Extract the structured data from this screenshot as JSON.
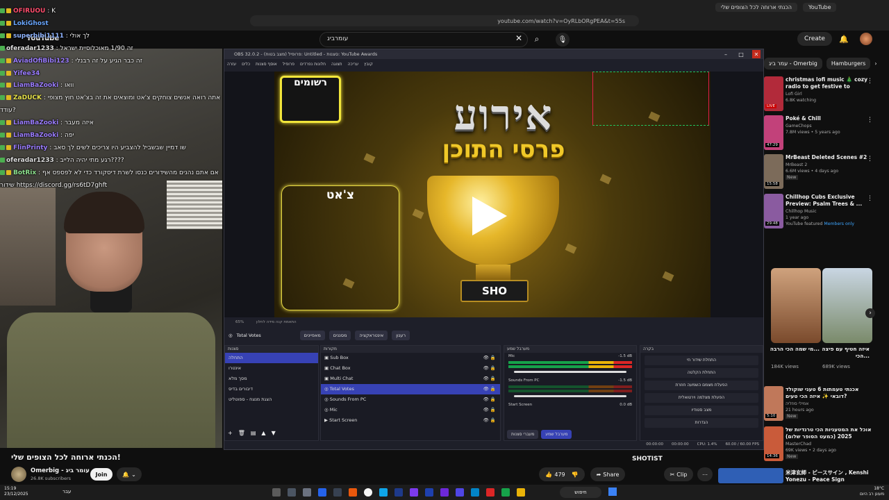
{
  "browser": {
    "tabs": [
      "הכנתי ארוחה לכל הצופים שלי",
      "YouTube"
    ],
    "url": "youtube.com/watch?v=OyRLbORgPEA&t=55s"
  },
  "yt": {
    "logo": "YouTube",
    "search_value": "עומרביג",
    "create_label": "Create"
  },
  "chat": [
    {
      "name": "OFIRUOU",
      "text": "K",
      "color": "#ff4d6d"
    },
    {
      "name": "LokiGhost",
      "text": "",
      "color": "#6aa7ff"
    },
    {
      "name": "superbibi1111",
      "text": "לך אולי",
      "color": "#8fb4ff"
    },
    {
      "name": "oferadar1233",
      "text": "זה 1/90 מאוכלוסיית ישראל",
      "color": "#dddddd"
    },
    {
      "name": "AviadOfiBibi123",
      "text": "זה כבר הגיע על זה רבנלי",
      "color": "#9b7dff"
    },
    {
      "name": "Yifee34",
      "text": "",
      "color": "#9b7dff"
    },
    {
      "name": "LiamBaZooki",
      "text": "וואו",
      "color": "#9b7dff"
    },
    {
      "name": "ZaDUCK",
      "text": "אתה רואה אנשים צוחקים צ'אט ומוצאים את זה בצ'אט חוץ מצופי",
      "color": "#e7e24a"
    },
    {
      "name": "",
      "text": "עודד?",
      "color": "#dddddd"
    },
    {
      "name": "LiamBaZooki",
      "text": "איזה מעבר",
      "color": "#9b7dff"
    },
    {
      "name": "LiamBaZooki",
      "text": "יפה",
      "color": "#9b7dff"
    },
    {
      "name": "FlinPrinty",
      "text": "שו דמיין שבשביל להצביע היו צריכים לשים לך סאב",
      "color": "#9b7dff"
    },
    {
      "name": "oferadar1233",
      "text": "רגע מתי יהיה הלייב????",
      "color": "#dddddd"
    },
    {
      "name": "BotRix",
      "text": "אם אתם נהנים מהשידורים כנסו לשרת דיסקורד כדי לא לפספס אף",
      "color": "#8fe38f"
    },
    {
      "name": "",
      "text": "שידור https://discord.gg/rs6tD7ghft",
      "color": "#dddddd"
    }
  ],
  "obs": {
    "title": "OBS 32.0.2 - פרופיל (מצב בטוח): Untitled - סצנות: YouTube Awards",
    "menu": [
      "עזרה",
      "כלים",
      "אוסף סצנות",
      "פרופיל",
      "חלונות נפרדים",
      "תצוגה",
      "עריכה",
      "קובץ"
    ],
    "preview": {
      "title": "אירוע",
      "subtitle": "פרסי התוכן",
      "sign_label": "רשומים",
      "chat_label": "צ'אט",
      "base_label": "SHO"
    },
    "zoom": "65%",
    "zoom_note": "התאמת קנה מידה לחלון",
    "scene_name": "Total Votes",
    "scene_buttons": [
      "מאפיינים",
      "מסננים",
      "אינטראקציה",
      "רענון"
    ],
    "docks": {
      "scenes_title": "סצנות",
      "scenes": [
        "התחלה",
        "אינטרו",
        "מסך מלא",
        "דיבורים בדיס",
        "הצגת מנצח - ספוטליט"
      ],
      "sources_title": "מקורות",
      "sources": [
        "Sub Box",
        "Chat Box",
        "Multi Chat",
        "Total Votes",
        "Sounds From PC",
        "Mic",
        "Start Screen"
      ],
      "mixer_title": "מערבל שמע",
      "mixer": [
        {
          "name": "Mic",
          "db": "-1.5 dB"
        },
        {
          "name": "Sounds From PC",
          "db": "-1.5 dB"
        },
        {
          "name": "Start Screen",
          "db": "0.0 dB"
        }
      ],
      "mixer_tabs": [
        "מעברי סצנות",
        "מערבל שמע"
      ],
      "controls_title": "בקרה",
      "controls": [
        "התחלת שידור חי",
        "התחלת הקלטה",
        "הפעלת מצמם השמעה חוזרת",
        "הפעלת מצלמה וירטואלית",
        "מצב סטודיו",
        "הגדרות"
      ]
    },
    "status": {
      "time1": "00:00:00",
      "time2": "00:00:00",
      "cpu": "CPU: 1.4%",
      "fps": "60.00 / 60.00 FPS"
    }
  },
  "sidebar": {
    "chips": [
      "עמר ביג - Omerbig",
      "Hamburgers"
    ],
    "recs": [
      {
        "title": "christmas lofi music 🎄 cozy radio to get festive to",
        "channel": "Lofi Girl",
        "meta": "6.8K watching",
        "badge": "LIVE",
        "color": "#b22a3a"
      },
      {
        "title": "Poké & Chill",
        "channel": "GameChops",
        "meta": "7.8M views • 5 years ago",
        "badge": "47:29",
        "color": "#c2417a"
      },
      {
        "title": "MrBeast Deleted Scenes #2",
        "channel": "MrBeast 2",
        "meta": "6.6M views • 4 days ago",
        "badge": "15:58",
        "color": "#7c6b5a"
      },
      {
        "title": "Chillhop Cubs Exclusive Preview: Psalm Trees & ...",
        "channel": "Chillhop Music",
        "meta": "1 year ago",
        "badge": "29:48",
        "color": "#8a5ba0"
      }
    ],
    "rec_new": "New",
    "rec_featured": "YouTube featured",
    "rec_members": "Members only",
    "shorts": [
      {
        "title": "מי שמה הכי הרבה...",
        "views": "184K views",
        "color": "#d9a074"
      },
      {
        "title": "איזה חטיף עם פיצה הכי...",
        "views": "689K views",
        "color": "#b7c9d8"
      }
    ],
    "recs2": [
      {
        "title": "אכנתי טעמתות 6 טעני שוקולד דובאי ✨ איזה הכי טעים?",
        "channel": "אמילי סוזליה",
        "meta": "21 hours ago",
        "badge": "5:10",
        "color": "#c0785a"
      },
      {
        "title": "אוכל את המטעניות הכי טרנדיות של 2025 (כמעט הסופר שלום)",
        "channel": "MasterChad",
        "meta": "69K views • 2 days ago",
        "badge": "14:36",
        "color": "#c95b3a"
      },
      {
        "title": "米津玄師 - ピースサイン , Kenshi Yonezu - Peace Sign",
        "channel": "",
        "meta": "",
        "badge": "",
        "color": "#2f5fb5"
      }
    ]
  },
  "video": {
    "title": "הכנתי ארוחה לכל הצופים שלי!",
    "channel": "Omerbig - עומר ביג",
    "subs": "26.8K subscribers",
    "join": "Join",
    "likes": "479",
    "share": "Share",
    "clip": "Clip",
    "ticker": "SHOTIST"
  },
  "taskbar": {
    "time": "15:19",
    "date": "23/12/2025",
    "weather": "18°C",
    "weather_note": "מעונן רב היום",
    "search": "חיפוש",
    "lang": "עבר"
  }
}
